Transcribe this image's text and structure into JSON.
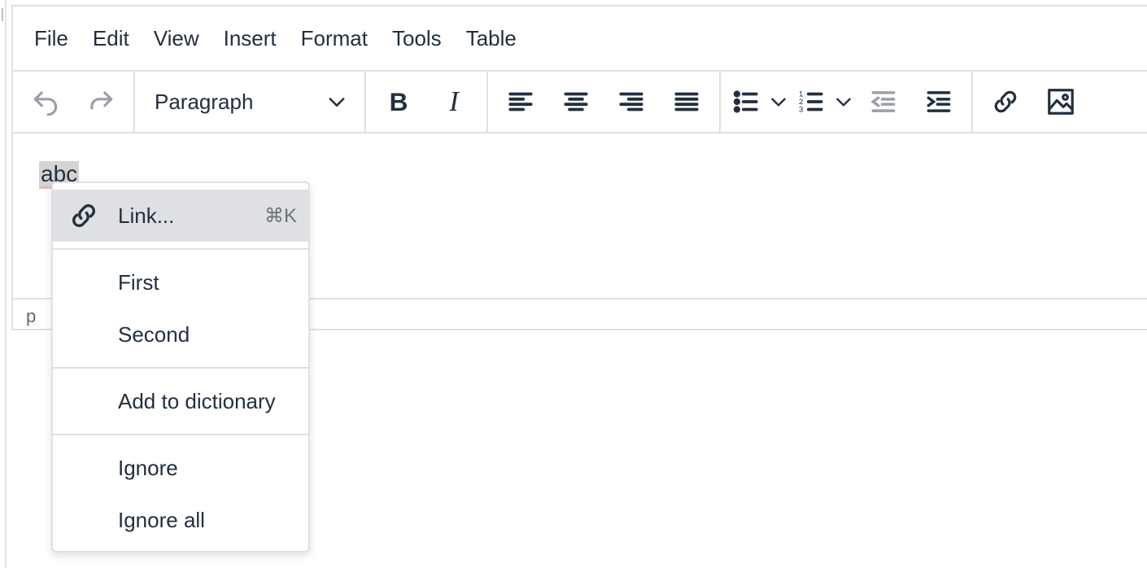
{
  "menubar": {
    "items": [
      "File",
      "Edit",
      "View",
      "Insert",
      "Format",
      "Tools",
      "Table"
    ]
  },
  "toolbar": {
    "block_format": "Paragraph",
    "icons": {
      "undo": "undo-icon",
      "redo": "redo-icon",
      "bold": "bold-icon",
      "italic": "italic-icon",
      "align_left": "align-left-icon",
      "align_center": "align-center-icon",
      "align_right": "align-right-icon",
      "align_justify": "align-justify-icon",
      "bullet_list": "bullet-list-icon",
      "numbered_list": "numbered-list-icon",
      "outdent": "outdent-icon",
      "indent": "indent-icon",
      "link": "link-icon",
      "image": "image-icon"
    }
  },
  "content": {
    "text": "abc"
  },
  "statusbar": {
    "path": "p"
  },
  "context_menu": {
    "link_label": "Link...",
    "link_shortcut": "⌘K",
    "suggestions": [
      "First",
      "Second"
    ],
    "add_to_dictionary": "Add to dictionary",
    "ignore": "Ignore",
    "ignore_all": "Ignore all"
  },
  "colors": {
    "border": "#dee0e3",
    "text": "#222f3e",
    "active_item_bg": "#dee0e3",
    "selection_bg": "#d4d4d4"
  }
}
